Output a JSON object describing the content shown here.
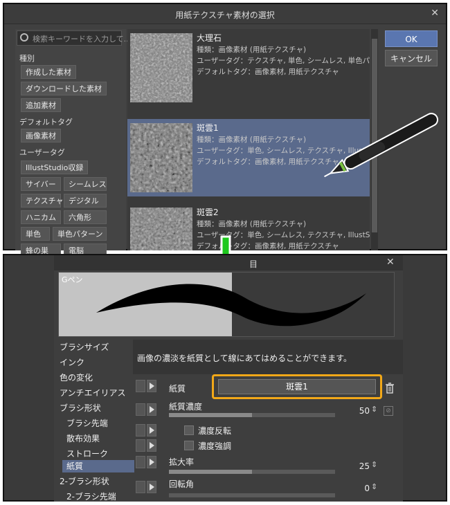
{
  "dialog": {
    "title": "用紙テクスチャ素材の選択",
    "search_placeholder": "検索キーワードを入力して...",
    "sections": {
      "kind": "種別",
      "default_tag": "デフォルトタグ",
      "user_tag": "ユーザータグ"
    },
    "kind_tags": [
      "作成した素材",
      "ダウンロードした素材",
      "追加素材"
    ],
    "default_tags": [
      "画像素材"
    ],
    "user_tags": [
      "IllustStudio収録",
      "サイバー",
      "シームレス",
      "テクスチャ",
      "デジタル",
      "ハニカム",
      "六角形",
      "単色",
      "単色パターン",
      "蜂の巣",
      "電脳"
    ],
    "ok": "OK",
    "cancel": "キャンセル",
    "materials": [
      {
        "name": "大理石",
        "lines": [
          "種類：画像素材 (用紙テクスチャ)",
          "ユーザータグ：テクスチャ, 単色, シームレス, 単色パターン",
          "デフォルトタグ：画像素材, 用紙テクスチャ"
        ]
      },
      {
        "name": "斑雲1",
        "lines": [
          "種類：画像素材 (用紙テクスチャ)",
          "ユーザータグ：単色, シームレス, テクスチャ, IllustStudio収録, 単色パ",
          "デフォルトタグ：画像素材, 用紙テクスチャ"
        ]
      },
      {
        "name": "斑雲2",
        "lines": [
          "種類：画像素材 (用紙テクスチャ)",
          "ユーザータグ：単色, シームレス, テクスチャ, IllustStudio収録, 単色パター",
          "デフォルトタグ：画像素材, 用紙テクスチャ"
        ]
      }
    ]
  },
  "panel": {
    "title_partial": "目",
    "preview_label": "Gペン",
    "categories": [
      "ブラシサイズ",
      "インク",
      "色の変化",
      "アンチエイリアス",
      "ブラシ形状",
      "ブラシ先端",
      "散布効果",
      "ストローク",
      "紙質",
      "2-ブラシ形状",
      "2-ブラシ先端"
    ],
    "description": "画像の濃淡を紙質として線にあてはめることができます。",
    "paper": {
      "label": "紙質",
      "value": "斑雲1"
    },
    "paper_density": {
      "label": "紙質濃度",
      "value": "50",
      "level": 0.5
    },
    "invert_density": {
      "label": "濃度反転",
      "checked": false
    },
    "emphasize_density": {
      "label": "濃度強調",
      "checked": false
    },
    "scale": {
      "label": "拡大率",
      "value": "25",
      "level": 0.5
    },
    "rotation": {
      "label": "回転角",
      "value": "0",
      "level": 0.0
    }
  },
  "colors": {
    "highlight": "#f2a818",
    "arrow": "#1ec81e",
    "selection": "#5a6a8c",
    "ok_button": "#5a76b0"
  }
}
